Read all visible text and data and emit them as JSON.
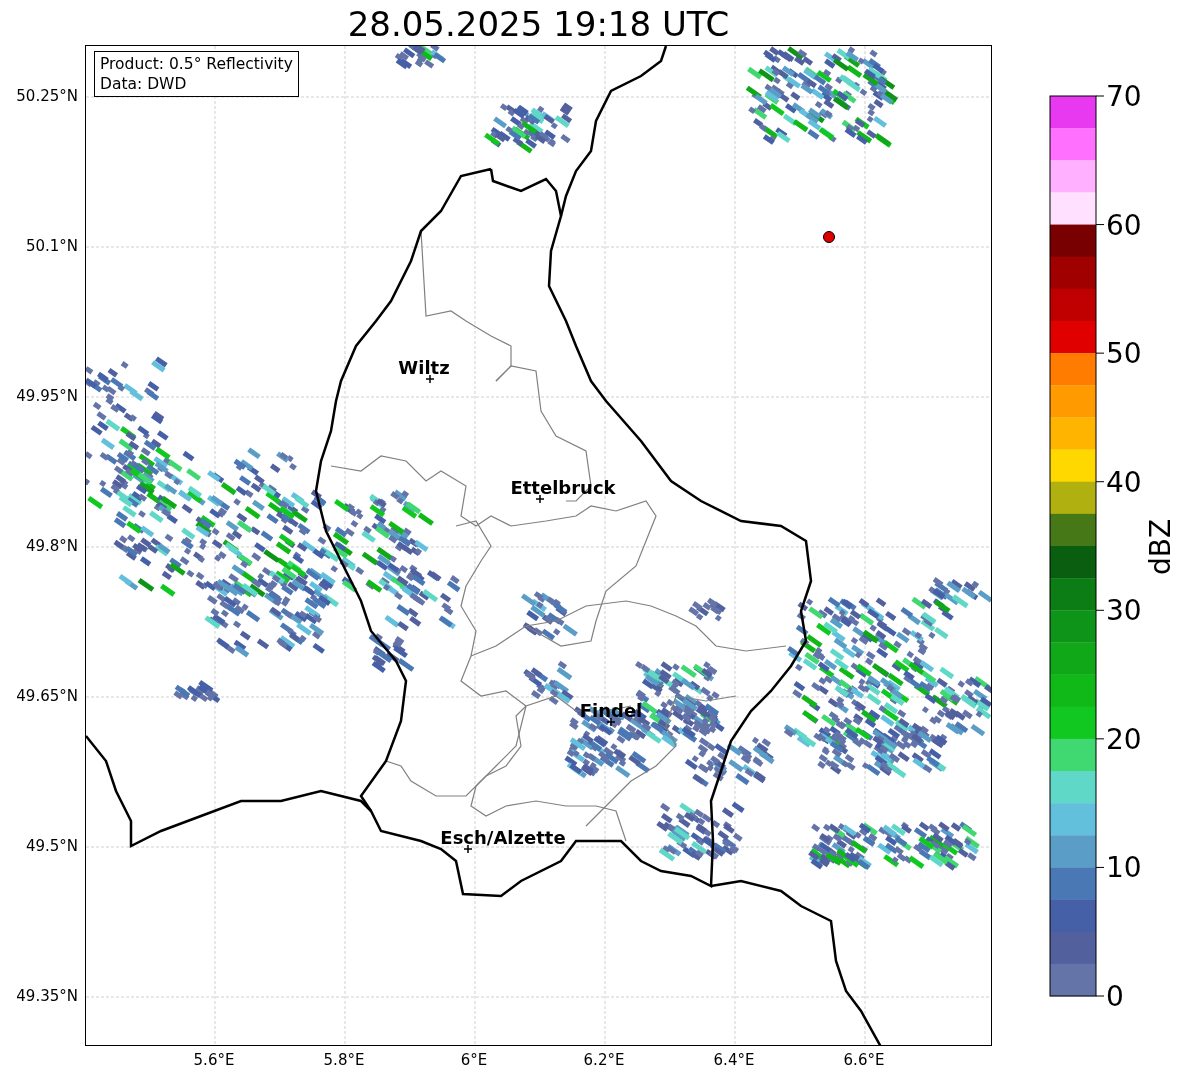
{
  "title": "28.05.2025 19:18 UTC",
  "info_box": [
    "Product: 0.5° Reflectivity",
    "Data: DWD"
  ],
  "map": {
    "cities": [
      "Wiltz",
      "Ettelbruck",
      "Findel",
      "Esch/Alzette"
    ],
    "x_ticks": [
      "5.6°E",
      "5.8°E",
      "6°E",
      "6.2°E",
      "6.4°E",
      "6.6°E"
    ],
    "y_ticks": [
      "50.25°N",
      "50.1°N",
      "49.95°N",
      "49.8°N",
      "49.65°N",
      "49.5°N",
      "49.35°N"
    ]
  },
  "colorbar": {
    "label": "dBZ",
    "ticks": [
      "70",
      "60",
      "50",
      "40",
      "30",
      "20",
      "10",
      "0"
    ],
    "bins": [
      {
        "color": "#e838f0"
      },
      {
        "color": "#ff70ff"
      },
      {
        "color": "#ffb0ff"
      },
      {
        "color": "#ffe0ff"
      },
      {
        "color": "#780000"
      },
      {
        "color": "#a00000"
      },
      {
        "color": "#c00000"
      },
      {
        "color": "#e00000"
      },
      {
        "color": "#ff7c00"
      },
      {
        "color": "#ff9a00"
      },
      {
        "color": "#ffb400"
      },
      {
        "color": "#ffd800"
      },
      {
        "color": "#b0b010"
      },
      {
        "color": "#467818"
      },
      {
        "color": "#0a5e10"
      },
      {
        "color": "#0c7c14"
      },
      {
        "color": "#0e9418"
      },
      {
        "color": "#10a818"
      },
      {
        "color": "#10b818"
      },
      {
        "color": "#10c820"
      },
      {
        "color": "#40d870"
      },
      {
        "color": "#60d8c8"
      },
      {
        "color": "#62c0dc"
      },
      {
        "color": "#5a9ec8"
      },
      {
        "color": "#4a78b4"
      },
      {
        "color": "#4660a8"
      },
      {
        "color": "#52609e"
      },
      {
        "color": "#6474a8"
      }
    ]
  }
}
